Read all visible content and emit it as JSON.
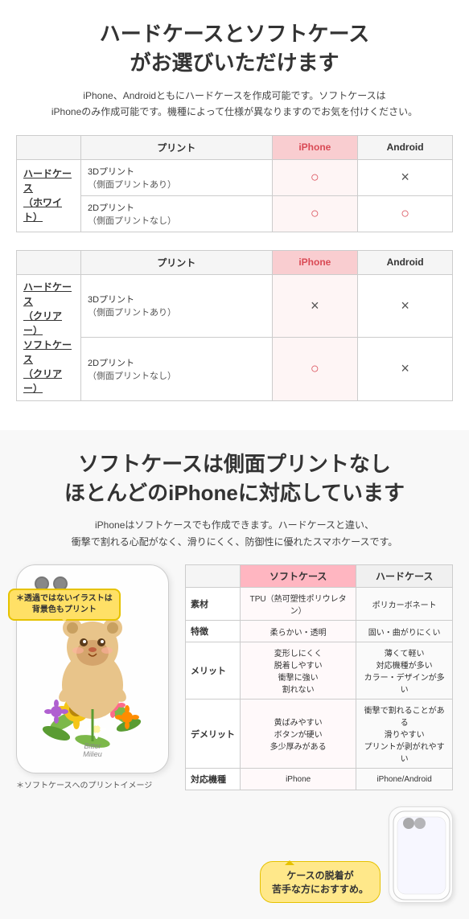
{
  "section1": {
    "title": "ハードケースとソフトケース\nがお選びいただけます",
    "desc": "iPhone、Androidともにハードケースを作成可能です。ソフトケースは\niPhoneのみ作成可能です。機種によって仕様が異なりますのでお気を付けください。",
    "table1": {
      "col_print": "プリント",
      "col_iphone": "iPhone",
      "col_android": "Android",
      "row_label": "ハードケース\n（ホワイト）",
      "rows": [
        {
          "label": "3Dプリント\n（側面プリントあり）",
          "iphone": "○",
          "android": "×"
        },
        {
          "label": "2Dプリント\n（側面プリントなし）",
          "iphone": "○",
          "android": "○"
        }
      ]
    },
    "table2": {
      "col_print": "プリント",
      "col_iphone": "iPhone",
      "col_android": "Android",
      "row_label1": "ハードケース\n（クリアー）",
      "row_label2": "ソフトケース\n（クリアー）",
      "rows": [
        {
          "label": "3Dプリント\n（側面プリントあり）",
          "iphone": "×",
          "android": "×"
        },
        {
          "label": "2Dプリント\n（側面プリントなし）",
          "iphone": "○",
          "android": "×"
        }
      ]
    }
  },
  "section2": {
    "title": "ソフトケースは側面プリントなし\nほとんどのiPhoneに対応しています",
    "desc": "iPhoneはソフトケースでも作成できます。ハードケースと違い、\n衝撃で割れる心配がなく、滑りにくく、防御性に優れたスマホケースです。",
    "balloon_text": "＊透過ではないイラストは\n背景色もプリント",
    "phone_brand": "Bitter\nMilieu",
    "phone_note": "＊ソフトケースへのプリントイメージ",
    "table": {
      "col_soft": "ソフトケース",
      "col_hard": "ハードケース",
      "rows": [
        {
          "label": "素材",
          "soft": "TPU（熱可塑性ポリウレタン）",
          "hard": "ポリカーボネート"
        },
        {
          "label": "特徴",
          "soft": "柔らかい・透明",
          "hard": "固い・曲がりにくい"
        },
        {
          "label": "メリット",
          "soft": "変形しにくく\n脱着しやすい\n衝撃に強い\n割れない",
          "hard": "薄くて軽い\n対応機種が多い\nカラー・デザインが多い"
        },
        {
          "label": "デメリット",
          "soft": "黄ばみやすい\nボタンが硬い\n多少厚みがある",
          "hard": "衝撃で割れることがある\n滑りやすい\nプリントが剥がれやすい"
        },
        {
          "label": "対応機種",
          "soft": "iPhone",
          "hard": "iPhone/Android"
        }
      ]
    },
    "bottom_balloon": "ケースの脱着が\n苦手な方におすすめ。"
  }
}
